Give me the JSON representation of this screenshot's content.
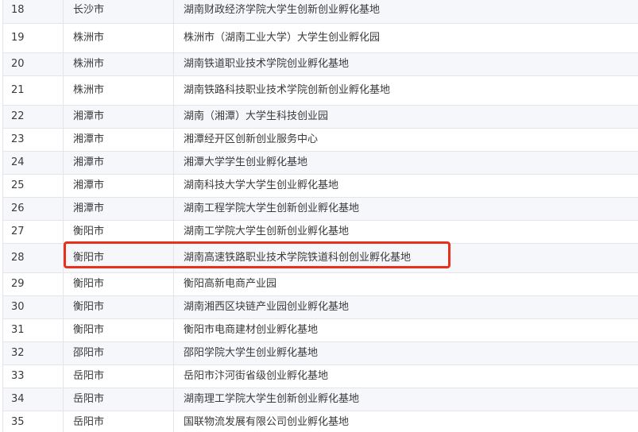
{
  "table": {
    "rows": [
      {
        "num": "18",
        "city": "长沙市",
        "name": "湖南财政经济学院大学生创新创业孵化基地"
      },
      {
        "num": "19",
        "city": "株洲市",
        "name": "株洲市（湖南工业大学）大学生创业孵化园"
      },
      {
        "num": "20",
        "city": "株洲市",
        "name": "湖南铁道职业技术学院创业孵化基地"
      },
      {
        "num": "21",
        "city": "株洲市",
        "name": "湖南铁路科技职业技术学院创新创业孵化基地"
      },
      {
        "num": "22",
        "city": "湘潭市",
        "name": "湖南（湘潭）大学生科技创业园"
      },
      {
        "num": "23",
        "city": "湘潭市",
        "name": "湘潭经开区创新创业服务中心"
      },
      {
        "num": "24",
        "city": "湘潭市",
        "name": "湘潭大学学生创业孵化基地"
      },
      {
        "num": "25",
        "city": "湘潭市",
        "name": "湖南科技大学大学生创业孵化基地"
      },
      {
        "num": "26",
        "city": "湘潭市",
        "name": "湖南工程学院大学生创新创业孵化基地"
      },
      {
        "num": "27",
        "city": "衡阳市",
        "name": "湖南工学院大学生创新创业孵化基地"
      },
      {
        "num": "28",
        "city": "衡阳市",
        "name": "湖南高速铁路职业技术学院铁道科创创业孵化基地"
      },
      {
        "num": "29",
        "city": "衡阳市",
        "name": "衡阳高新电商产业园"
      },
      {
        "num": "30",
        "city": "衡阳市",
        "name": "湖南湘西区块链产业园创业孵化基地"
      },
      {
        "num": "31",
        "city": "衡阳市",
        "name": "衡阳市电商建材创业孵化基地"
      },
      {
        "num": "32",
        "city": "邵阳市",
        "name": "邵阳学院大学生创业孵化基地"
      },
      {
        "num": "33",
        "city": "岳阳市",
        "name": "岳阳市汴河街省级创业孵化基地"
      },
      {
        "num": "34",
        "city": "岳阳市",
        "name": "湖南理工学院大学生创新创业孵化基地"
      },
      {
        "num": "35",
        "city": "岳阳市",
        "name": "国联物流发展有限公司创业孵化基地"
      }
    ]
  },
  "highlight": {
    "row_num": "28",
    "color": "#e8301c"
  },
  "colors": {
    "stripe": "#f5f7fb",
    "border": "#e3e5ea",
    "text": "#3a3a3a"
  }
}
